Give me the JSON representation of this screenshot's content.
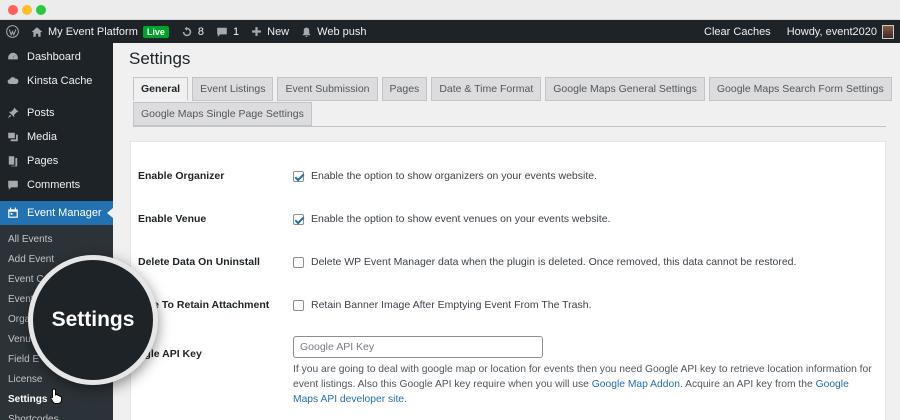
{
  "adminbar": {
    "site_name": "My Event Platform",
    "live_badge": "Live",
    "updates_count": "8",
    "comments_count": "1",
    "new_label": "New",
    "webpush_label": "Web push",
    "clear_caches": "Clear Caches",
    "howdy": "Howdy, event2020"
  },
  "sidebar": {
    "items": [
      {
        "label": "Dashboard",
        "icon": "dashboard-icon"
      },
      {
        "label": "Kinsta Cache",
        "icon": "cloud-icon"
      },
      {
        "label": "Posts",
        "icon": "pin-icon"
      },
      {
        "label": "Media",
        "icon": "media-icon"
      },
      {
        "label": "Pages",
        "icon": "pages-icon"
      },
      {
        "label": "Comments",
        "icon": "comment-icon"
      },
      {
        "label": "Event Manager",
        "icon": "calendar-icon"
      }
    ],
    "submenu": [
      "All Events",
      "Add Event",
      "Event Cate",
      "Event T",
      "Orga",
      "Venu",
      "Field E",
      "License",
      "Settings",
      "Shortcodes"
    ]
  },
  "page": {
    "title": "Settings"
  },
  "tabs": {
    "row1": [
      "General",
      "Event Listings",
      "Event Submission",
      "Pages",
      "Date & Time Format",
      "Google Maps General Settings",
      "Google Maps Search Form Settings"
    ],
    "row2": [
      "Google Maps Single Page Settings"
    ]
  },
  "settings": {
    "enable_organizer": {
      "label": "Enable Organizer",
      "desc": "Enable the option to show organizers on your events website."
    },
    "enable_venue": {
      "label": "Enable Venue",
      "desc": "Enable the option to show event venues on your events website."
    },
    "delete_data": {
      "label": "Delete Data On Uninstall",
      "desc": "Delete WP Event Manager data when the plugin is deleted. Once removed, this data cannot be restored."
    },
    "retain_attachment": {
      "label": "able To Retain Attachment",
      "desc": "Retain Banner Image After Emptying Event From The Trash."
    },
    "api_key": {
      "label": "ogle API Key",
      "placeholder": "Google API Key",
      "desc_1": "If you are going to deal with google map or location for events then you need Google API key to retrieve location information for event listings. Also this Google API key require when you will use ",
      "link_1": "Google Map Addon",
      "desc_2": ". Acquire an API key from the ",
      "link_2": "Google Maps API developer site",
      "desc_3": "."
    }
  },
  "magnifier": {
    "label": "Settings"
  },
  "colors": {
    "accent": "#2271b1",
    "adminbar": "#1d2327",
    "live": "#00a32a"
  }
}
